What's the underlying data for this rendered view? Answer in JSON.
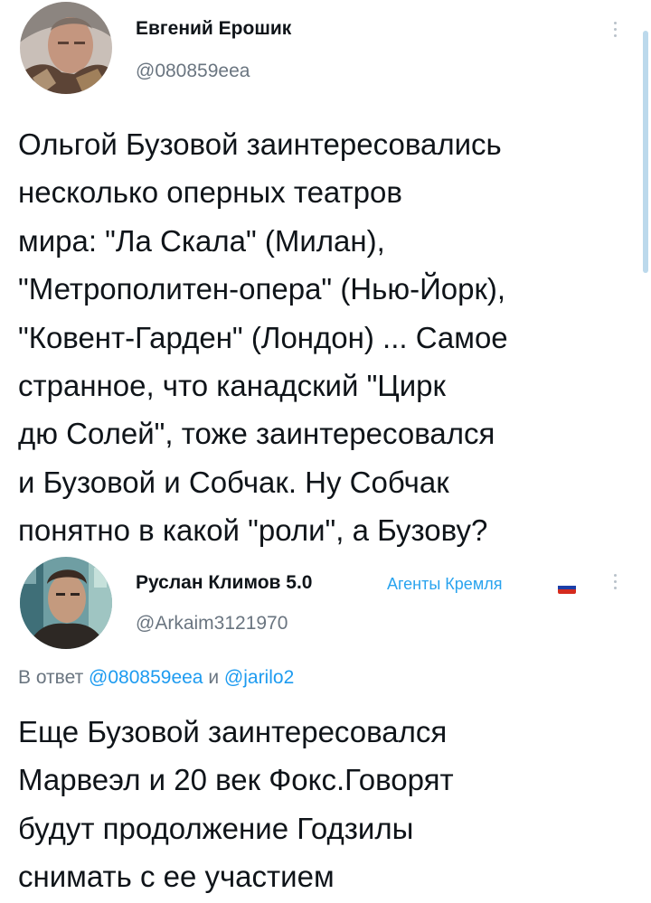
{
  "scrollbar": {
    "color": "#bcd9ec"
  },
  "tweets": [
    {
      "author": {
        "name": "Евгений Ерошик",
        "handle": "@080859eea",
        "avatar": "person-avatar-photo"
      },
      "more_icon": "vertical-dots-icon",
      "text": "Ольгой Бузовой заинтересовались\nнесколько оперных театров\nмира: \"Ла Скала\" (Милан),\n\"Метрополитен-опера\" (Нью-Йорк),\n\"Ковент-Гарден\" (Лондон) ... Самое\nстранное, что канадский \"Цирк\nдю Солей\", тоже заинтересовался\nи Бузовой и Собчак. Ну Собчак\nпонятно в какой \"роли\", а Бузову?"
    },
    {
      "author": {
        "name": "Руслан Климов 5.0",
        "handle": "@Arkaim3121970",
        "avatar": "person-avatar-photo",
        "badge": "Агенты Кремля",
        "badge_icon": "russian-flag-icon"
      },
      "more_icon": "vertical-dots-icon",
      "reply_to": {
        "prefix": "В ответ",
        "mention_1": "@080859eea",
        "conjunction": "и",
        "mention_2": "@jarilo2"
      },
      "text": "Еще Бузовой заинтересовался\nМарвеэл и 20 век Фокс.Говорят\nбудут продолжение Годзилы\nснимать с ее участием"
    }
  ],
  "colors": {
    "text": "#0f1419",
    "secondary": "#6a7580",
    "link": "#1d9bf0",
    "badge": "#29a3ee"
  }
}
